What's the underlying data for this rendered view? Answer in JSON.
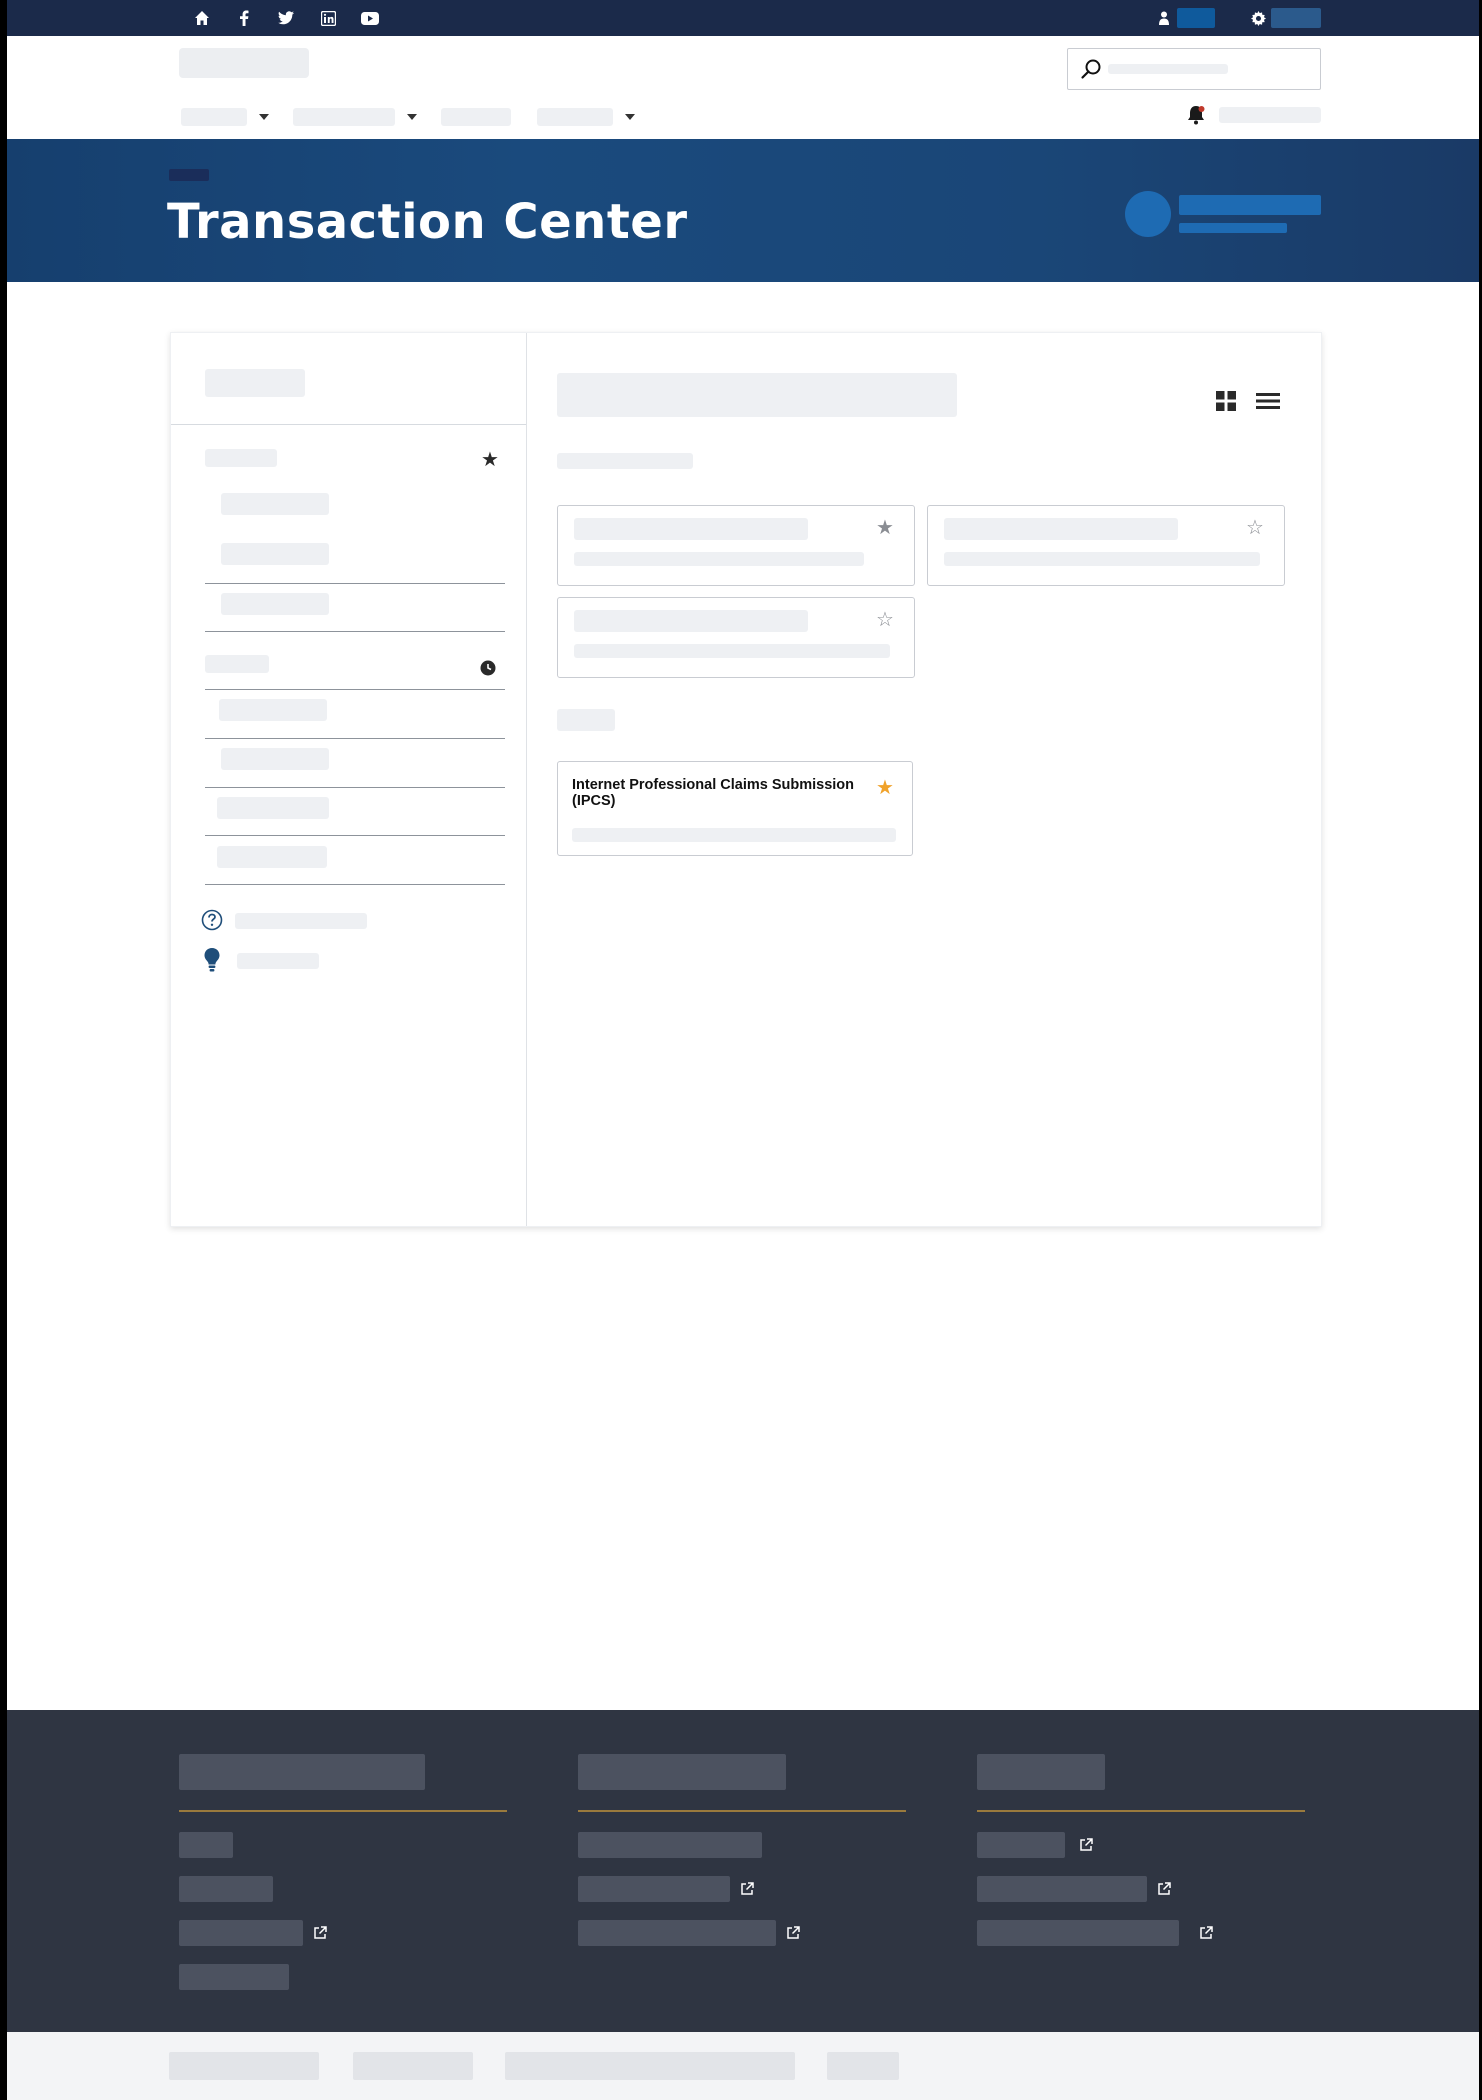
{
  "topbar": {
    "icons": [
      "home-icon",
      "facebook-icon",
      "twitter-icon",
      "linkedin-icon",
      "youtube-icon"
    ],
    "right_icons": [
      "user-icon",
      "gear-icon"
    ],
    "accent_color": "#0f5a9c"
  },
  "banner": {
    "title": "Transaction Center"
  },
  "content": {
    "view_icons": [
      "grid-view-icon",
      "list-view-icon"
    ],
    "featured_tile": {
      "title": "Internet Professional Claims Submission (IPCS)",
      "favorite": true,
      "star_color": "#f0a22a"
    }
  },
  "colors": {
    "topbar": "#1b2a4a",
    "banner": "#1a4a7d",
    "footer": "#2f3542",
    "footer_rule": "#9a7a3d"
  }
}
